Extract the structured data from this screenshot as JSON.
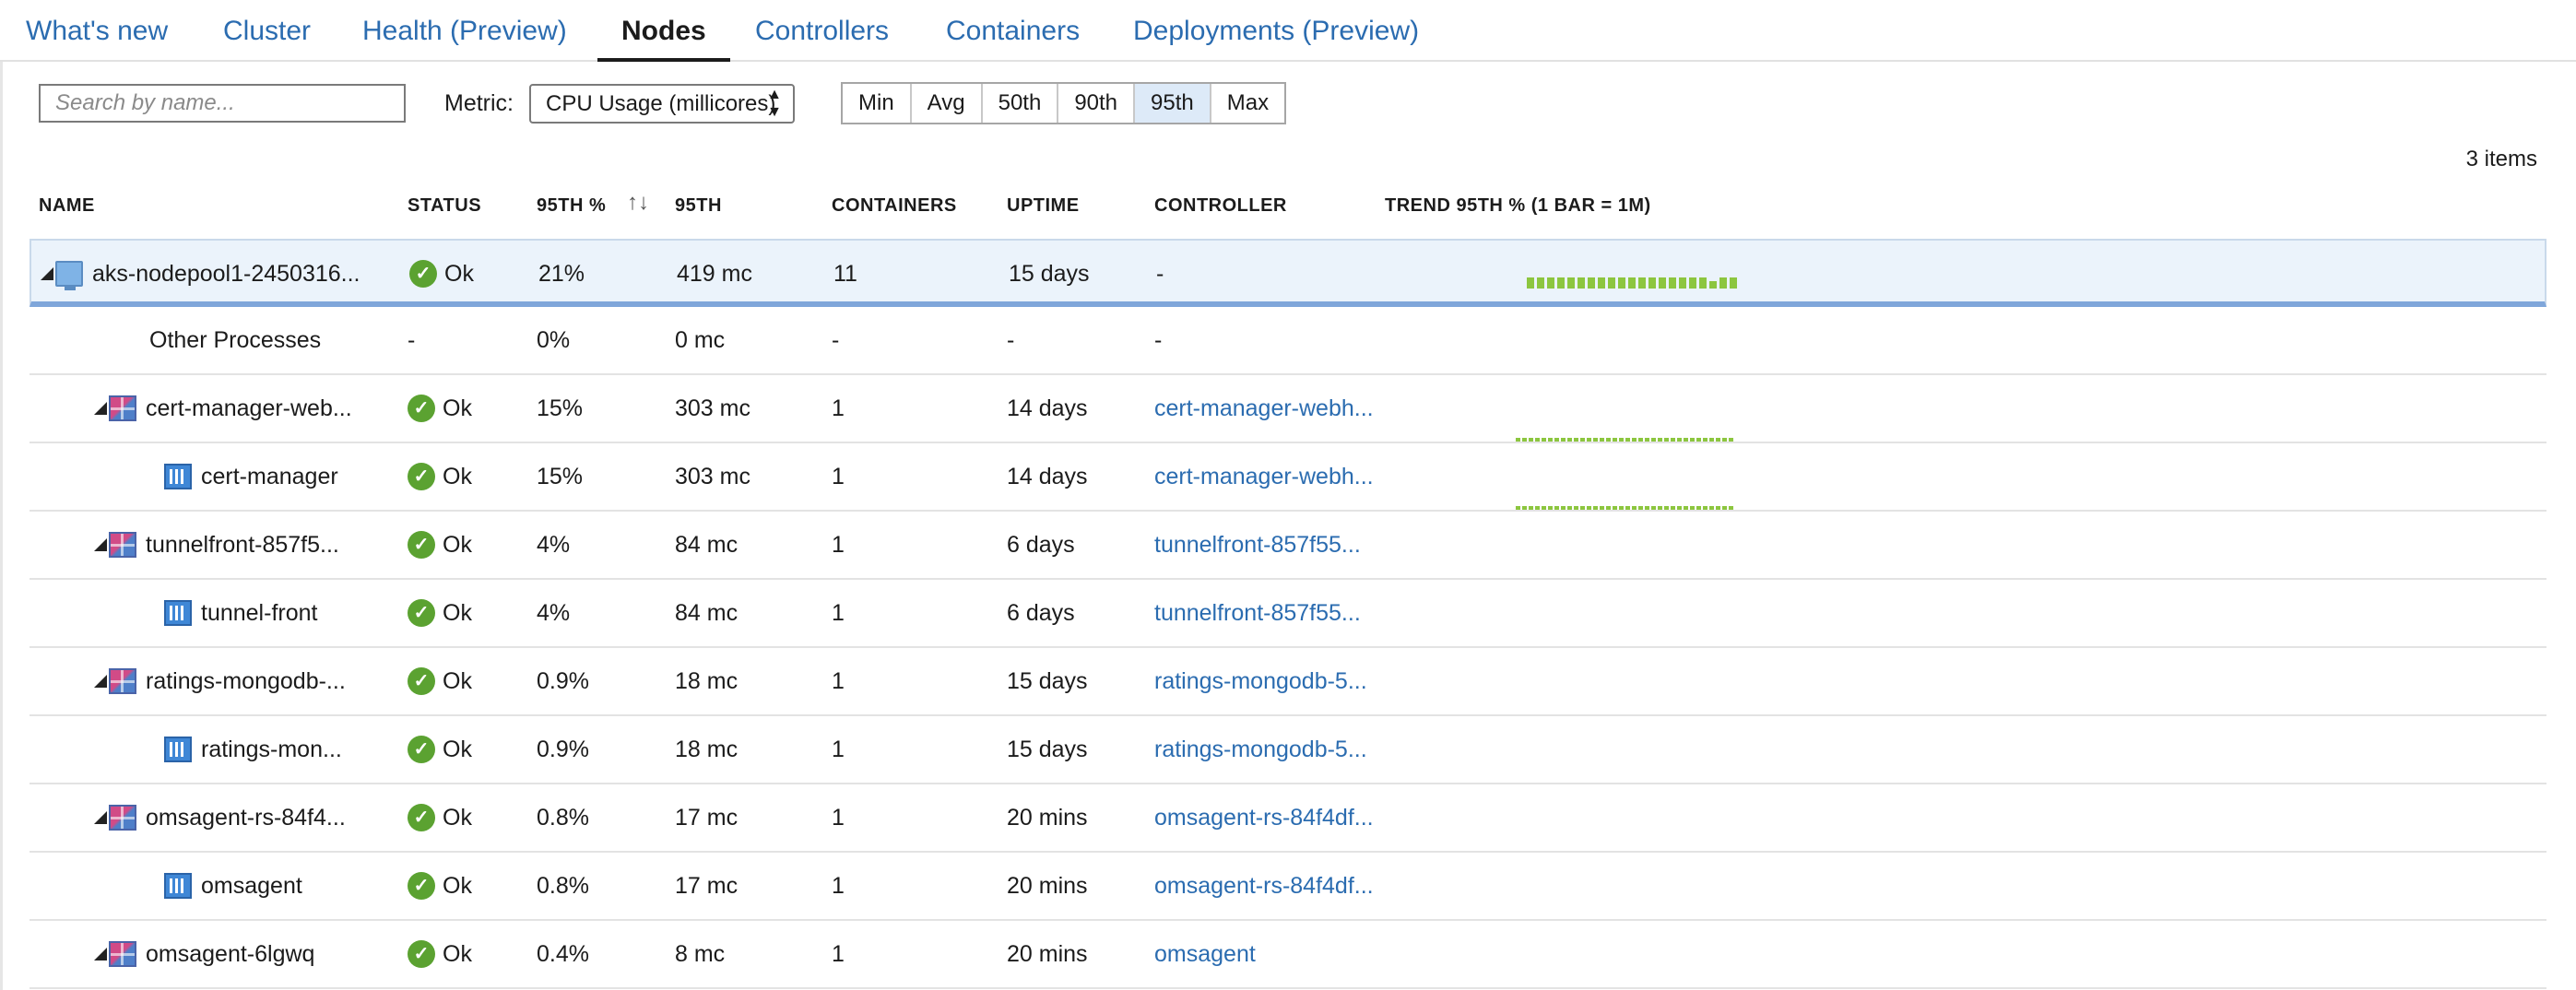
{
  "tabs": [
    {
      "label": "What's new",
      "active": false
    },
    {
      "label": "Cluster",
      "active": false
    },
    {
      "label": "Health (Preview)",
      "active": false
    },
    {
      "label": "Nodes",
      "active": true
    },
    {
      "label": "Controllers",
      "active": false
    },
    {
      "label": "Containers",
      "active": false
    },
    {
      "label": "Deployments (Preview)",
      "active": false
    }
  ],
  "toolbar": {
    "search_placeholder": "Search by name...",
    "metric_label": "Metric:",
    "metric_value": "CPU Usage (millicores)",
    "percentiles": [
      "Min",
      "Avg",
      "50th",
      "90th",
      "95th",
      "Max"
    ],
    "selected_percentile": "95th"
  },
  "items_count": "3 items",
  "columns": [
    "NAME",
    "STATUS",
    "95TH %",
    "95TH",
    "CONTAINERS",
    "UPTIME",
    "CONTROLLER",
    "TREND 95TH % (1 BAR = 1M)"
  ],
  "rows": [
    {
      "name": "aks-nodepool1-2450316...",
      "type": "node",
      "status": "Ok",
      "pct": "21%",
      "val": "419 mc",
      "containers": "11",
      "uptime": "15 days",
      "controller": "-",
      "controller_link": false,
      "trend": "solid",
      "selected": true
    },
    {
      "name": "Other Processes",
      "type": "other",
      "status": "-",
      "pct": "0%",
      "val": "0 mc",
      "containers": "-",
      "uptime": "-",
      "controller": "-",
      "controller_link": false,
      "trend": "none"
    },
    {
      "name": "cert-manager-web...",
      "type": "pod",
      "status": "Ok",
      "pct": "15%",
      "val": "303 mc",
      "containers": "1",
      "uptime": "14 days",
      "controller": "cert-manager-webh...",
      "controller_link": true,
      "trend": "dashed"
    },
    {
      "name": "cert-manager",
      "type": "container",
      "status": "Ok",
      "pct": "15%",
      "val": "303 mc",
      "containers": "1",
      "uptime": "14 days",
      "controller": "cert-manager-webh...",
      "controller_link": true,
      "trend": "dashed"
    },
    {
      "name": "tunnelfront-857f5...",
      "type": "pod",
      "status": "Ok",
      "pct": "4%",
      "val": "84 mc",
      "containers": "1",
      "uptime": "6 days",
      "controller": "tunnelfront-857f55...",
      "controller_link": true,
      "trend": "none"
    },
    {
      "name": "tunnel-front",
      "type": "container",
      "status": "Ok",
      "pct": "4%",
      "val": "84 mc",
      "containers": "1",
      "uptime": "6 days",
      "controller": "tunnelfront-857f55...",
      "controller_link": true,
      "trend": "none"
    },
    {
      "name": "ratings-mongodb-...",
      "type": "pod",
      "status": "Ok",
      "pct": "0.9%",
      "val": "18 mc",
      "containers": "1",
      "uptime": "15 days",
      "controller": "ratings-mongodb-5...",
      "controller_link": true,
      "trend": "none"
    },
    {
      "name": "ratings-mon...",
      "type": "container",
      "status": "Ok",
      "pct": "0.9%",
      "val": "18 mc",
      "containers": "1",
      "uptime": "15 days",
      "controller": "ratings-mongodb-5...",
      "controller_link": true,
      "trend": "none"
    },
    {
      "name": "omsagent-rs-84f4...",
      "type": "pod",
      "status": "Ok",
      "pct": "0.8%",
      "val": "17 mc",
      "containers": "1",
      "uptime": "20 mins",
      "controller": "omsagent-rs-84f4df...",
      "controller_link": true,
      "trend": "none"
    },
    {
      "name": "omsagent",
      "type": "container",
      "status": "Ok",
      "pct": "0.8%",
      "val": "17 mc",
      "containers": "1",
      "uptime": "20 mins",
      "controller": "omsagent-rs-84f4df...",
      "controller_link": true,
      "trend": "none"
    },
    {
      "name": "omsagent-6lgwq",
      "type": "pod",
      "status": "Ok",
      "pct": "0.4%",
      "val": "8 mc",
      "containers": "1",
      "uptime": "20 mins",
      "controller": "omsagent",
      "controller_link": true,
      "trend": "none"
    }
  ],
  "colors": {
    "link": "#2b6cb0",
    "ok": "#5ba231",
    "trend": "#8cc63f",
    "selected_row": "#ebf3fb"
  }
}
